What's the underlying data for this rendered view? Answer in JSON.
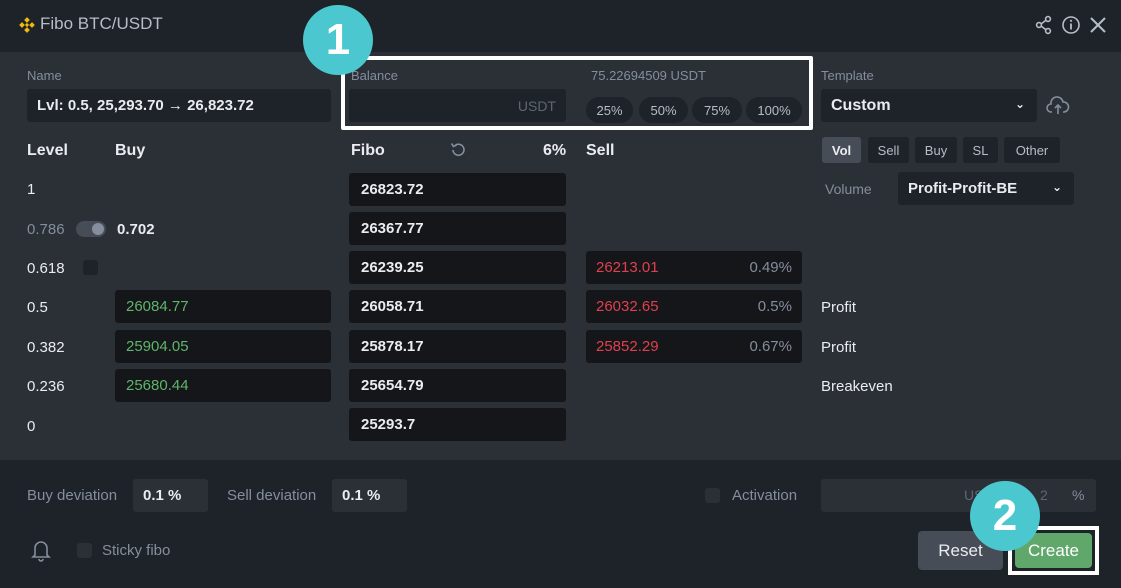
{
  "window": {
    "title": "Fibo BTC/USDT"
  },
  "form": {
    "name_label": "Name",
    "name_value": "Lvl: 0.5, 25,293.70 → 26,823.72",
    "balance_label": "Balance",
    "balance_placeholder": "USDT",
    "available": "75.22694509",
    "available_unit": "USDT",
    "percent_buttons": [
      "25%",
      "50%",
      "75%",
      "100%"
    ],
    "template_label": "Template",
    "template_value": "Custom"
  },
  "table": {
    "headers": {
      "level": "Level",
      "buy": "Buy",
      "fibo": "Fibo",
      "fibo_pct": "6%",
      "sell": "Sell"
    },
    "rows": [
      {
        "level": "1",
        "fibo": "26823.72"
      },
      {
        "level": "0.786",
        "buy_toggle_value": "0.702",
        "fibo": "26367.77"
      },
      {
        "level": "0.618",
        "fibo": "26239.25",
        "sell": "26213.01",
        "sell_pct": "0.49%"
      },
      {
        "level": "0.5",
        "buy": "26084.77",
        "fibo": "26058.71",
        "sell": "26032.65",
        "sell_pct": "0.5%",
        "right": "Profit"
      },
      {
        "level": "0.382",
        "buy": "25904.05",
        "fibo": "25878.17",
        "sell": "25852.29",
        "sell_pct": "0.67%",
        "right": "Profit"
      },
      {
        "level": "0.236",
        "buy": "25680.44",
        "fibo": "25654.79",
        "right": "Breakeven"
      },
      {
        "level": "0",
        "fibo": "25293.7"
      }
    ]
  },
  "tabs": [
    "Vol",
    "Sell",
    "Buy",
    "SL",
    "Other"
  ],
  "volume": {
    "label": "Volume",
    "value": "Profit-Profit-BE"
  },
  "footer": {
    "buy_deviation_label": "Buy deviation",
    "buy_deviation_value": "0.1 %",
    "sell_deviation_label": "Sell deviation",
    "sell_deviation_value": "0.1 %",
    "activation_label": "Activation",
    "activation_unit_partial": "US",
    "activation_pct_partial": "2",
    "activation_pct_unit": "%",
    "sticky_label": "Sticky fibo",
    "reset_label": "Reset",
    "create_label": "Create"
  },
  "annotations": {
    "badge1": "1",
    "badge2": "2"
  },
  "colors": {
    "background": "#2b2f36",
    "header": "#1e2329",
    "buy_green": "#5fb56a",
    "sell_red": "#e0404e",
    "create_green": "#5fa76a",
    "badge_teal": "#4bc8cf",
    "logo_yellow": "#f0b90b"
  }
}
